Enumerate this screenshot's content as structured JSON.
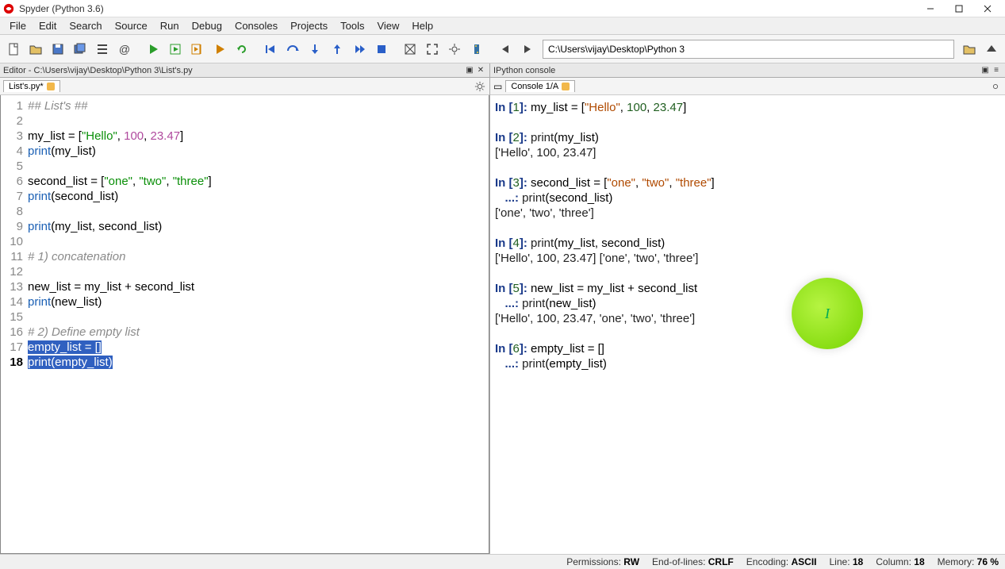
{
  "window": {
    "title": "Spyder (Python 3.6)"
  },
  "menus": [
    "File",
    "Edit",
    "Search",
    "Source",
    "Run",
    "Debug",
    "Consoles",
    "Projects",
    "Tools",
    "View",
    "Help"
  ],
  "toolbar_icons": [
    "new-file-icon",
    "open-file-icon",
    "save-icon",
    "save-all-icon",
    "outline-icon",
    "at-icon",
    "sep",
    "run-icon",
    "run-cell-icon",
    "run-cell-advance-icon",
    "run-selection-icon",
    "redo-run-icon",
    "sep",
    "debug-first-icon",
    "debug-step-over-icon",
    "debug-step-in-icon",
    "debug-step-out-icon",
    "debug-continue-icon",
    "debug-stop-icon",
    "sep",
    "maximize-icon",
    "fullscreen-icon",
    "preferences-icon",
    "python-path-icon",
    "sep",
    "nav-back-icon",
    "nav-fwd-icon"
  ],
  "path_value": "C:\\Users\\vijay\\Desktop\\Python 3",
  "editor": {
    "pane_title": "Editor - C:\\Users\\vijay\\Desktop\\Python 3\\List's.py",
    "tab_label": "List's.py*",
    "lines": [
      {
        "n": 1,
        "segs": [
          [
            "comment",
            "## List's ##"
          ]
        ]
      },
      {
        "n": 2,
        "segs": []
      },
      {
        "n": 3,
        "segs": [
          [
            "plain",
            "my_list = ["
          ],
          [
            "str",
            "\"Hello\""
          ],
          [
            "plain",
            ", "
          ],
          [
            "num",
            "100"
          ],
          [
            "plain",
            ", "
          ],
          [
            "num",
            "23.47"
          ],
          [
            "plain",
            "]"
          ]
        ]
      },
      {
        "n": 4,
        "segs": [
          [
            "func",
            "print"
          ],
          [
            "plain",
            "(my_list)"
          ]
        ]
      },
      {
        "n": 5,
        "segs": []
      },
      {
        "n": 6,
        "segs": [
          [
            "plain",
            "second_list = ["
          ],
          [
            "str",
            "\"one\""
          ],
          [
            "plain",
            ", "
          ],
          [
            "str",
            "\"two\""
          ],
          [
            "plain",
            ", "
          ],
          [
            "str",
            "\"three\""
          ],
          [
            "plain",
            "]"
          ]
        ]
      },
      {
        "n": 7,
        "segs": [
          [
            "func",
            "print"
          ],
          [
            "plain",
            "(second_list)"
          ]
        ]
      },
      {
        "n": 8,
        "segs": []
      },
      {
        "n": 9,
        "segs": [
          [
            "func",
            "print"
          ],
          [
            "plain",
            "(my_list, second_list)"
          ]
        ]
      },
      {
        "n": 10,
        "segs": []
      },
      {
        "n": 11,
        "segs": [
          [
            "comment",
            "# 1) concatenation"
          ]
        ]
      },
      {
        "n": 12,
        "segs": []
      },
      {
        "n": 13,
        "segs": [
          [
            "plain",
            "new_list = my_list + second_list"
          ]
        ]
      },
      {
        "n": 14,
        "segs": [
          [
            "func",
            "print"
          ],
          [
            "plain",
            "(new_list)"
          ]
        ]
      },
      {
        "n": 15,
        "segs": []
      },
      {
        "n": 16,
        "segs": [
          [
            "comment",
            "# 2) Define empty list"
          ]
        ]
      },
      {
        "n": 17,
        "selected": true,
        "segs": [
          [
            "plain",
            "empty_list = []"
          ]
        ]
      },
      {
        "n": 18,
        "selected": true,
        "current": true,
        "segs": [
          [
            "func",
            "print"
          ],
          [
            "plain",
            "(empty_list)"
          ]
        ]
      }
    ]
  },
  "console": {
    "pane_title": "IPython console",
    "tab_label": "Console 1/A",
    "blocks": [
      {
        "in_n": "1",
        "code_segs": [
          [
            [
              "plain",
              "my_list = ["
            ],
            [
              "str",
              "\"Hello\""
            ],
            [
              "plain",
              ", "
            ],
            [
              "num",
              "100"
            ],
            [
              "plain",
              ", "
            ],
            [
              "num",
              "23.47"
            ],
            [
              "plain",
              "]"
            ]
          ]
        ],
        "out": []
      },
      {
        "in_n": "2",
        "code_segs": [
          [
            [
              "plain",
              "print(my_list)"
            ]
          ]
        ],
        "out": [
          "['Hello', 100, 23.47]"
        ]
      },
      {
        "in_n": "3",
        "code_segs": [
          [
            [
              "plain",
              "second_list = ["
            ],
            [
              "str",
              "\"one\""
            ],
            [
              "plain",
              ", "
            ],
            [
              "str",
              "\"two\""
            ],
            [
              "plain",
              ", "
            ],
            [
              "str",
              "\"three\""
            ],
            [
              "plain",
              "]"
            ]
          ],
          [
            [
              "plain",
              "print(second_list)"
            ]
          ]
        ],
        "out": [
          "['one', 'two', 'three']"
        ]
      },
      {
        "in_n": "4",
        "code_segs": [
          [
            [
              "plain",
              "print(my_list, second_list)"
            ]
          ]
        ],
        "out": [
          "['Hello', 100, 23.47] ['one', 'two', 'three']"
        ]
      },
      {
        "in_n": "5",
        "code_segs": [
          [
            [
              "plain",
              "new_list = my_list + second_list"
            ]
          ],
          [
            [
              "plain",
              "print(new_list)"
            ]
          ]
        ],
        "out": [
          "['Hello', 100, 23.47, 'one', 'two', 'three']"
        ]
      },
      {
        "in_n": "6",
        "code_segs": [
          [
            [
              "plain",
              "empty_list = []"
            ]
          ],
          [
            [
              "plain",
              "print(empty_list)"
            ]
          ]
        ],
        "out": []
      }
    ]
  },
  "status": {
    "permissions_k": "Permissions:",
    "permissions_v": "RW",
    "eol_k": "End-of-lines:",
    "eol_v": "CRLF",
    "enc_k": "Encoding:",
    "enc_v": "ASCII",
    "line_k": "Line:",
    "line_v": "18",
    "col_k": "Column:",
    "col_v": "18",
    "mem_k": "Memory:",
    "mem_v": "76 %"
  }
}
